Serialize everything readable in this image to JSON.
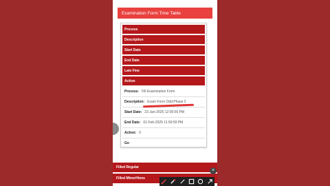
{
  "header": {
    "title": "Examination Form Time Table"
  },
  "table": {
    "headers": [
      "Process",
      "Description",
      "Start Date",
      "End Date",
      "Late Fine",
      "Action"
    ],
    "rows": [
      {
        "label": "Process:",
        "value": "Fill Examination Form"
      },
      {
        "label": "Description:",
        "value": "Exam Form Odd Phase 2"
      },
      {
        "label": "Start Date:",
        "value": "22-Jan-2025 12:00:00 PM"
      },
      {
        "label": "End Date:",
        "value": "01-Feb-2025 11:59:59 PM"
      },
      {
        "label": "Action:",
        "value": "0"
      },
      {
        "label": "Go",
        "value": ""
      }
    ]
  },
  "bottom_menu": [
    "Filled Regular",
    "Filled Minor/Hons"
  ],
  "colors": {
    "background": "#9c2a2b",
    "header": "#e8413f",
    "table_header": "#b4181b",
    "annotation": "#e03434"
  },
  "toolbar": {
    "tools": [
      "brush-icon",
      "eraser-icon",
      "pen-icon",
      "square-icon",
      "circle-icon",
      "arrow-icon"
    ]
  }
}
